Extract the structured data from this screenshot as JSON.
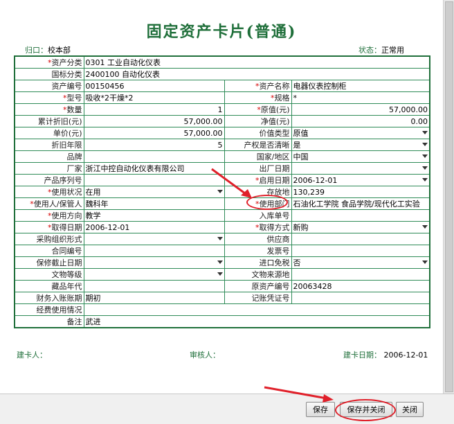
{
  "title": "固定资产卡片(普通)",
  "header": {
    "owner_label": "归口：",
    "owner_value": "校本部",
    "status_label": "状态：",
    "status_value": "正常用"
  },
  "fields": {
    "asset_category": {
      "label": "资产分类",
      "value": "0301 工业自动化仪表"
    },
    "national_category": {
      "label": "国标分类",
      "value": "2400100 自动化仪表"
    },
    "asset_no": {
      "label": "资产编号",
      "value": "00150456"
    },
    "asset_name": {
      "label": "资产名称",
      "value": "电器仪表控制柜"
    },
    "model": {
      "label": "型号",
      "value": "吸收*2干燥*2"
    },
    "spec": {
      "label": "规格",
      "value": "*"
    },
    "quantity": {
      "label": "数量",
      "value": "1"
    },
    "original_value": {
      "label": "原值(元)",
      "value": "57,000.00"
    },
    "accum_depr": {
      "label": "累计折旧(元)",
      "value": "57,000.00"
    },
    "net_value": {
      "label": "净值(元)",
      "value": "0.00"
    },
    "unit_price": {
      "label": "单价(元)",
      "value": "57,000.00"
    },
    "value_type": {
      "label": "价值类型",
      "value": "原值"
    },
    "depr_years": {
      "label": "折旧年限",
      "value": "5"
    },
    "ownership_clear": {
      "label": "产权是否清晰",
      "value": "是"
    },
    "brand": {
      "label": "品牌",
      "value": ""
    },
    "country": {
      "label": "国家/地区",
      "value": "中国"
    },
    "manufacturer": {
      "label": "厂家",
      "value": "浙江中控自动化仪表有限公司"
    },
    "factory_date": {
      "label": "出厂日期",
      "value": ""
    },
    "serial_no": {
      "label": "产品序列号",
      "value": ""
    },
    "start_date": {
      "label": "启用日期",
      "value": "2006-12-01"
    },
    "use_status": {
      "label": "使用状况",
      "value": "在用"
    },
    "location": {
      "label": "存放地",
      "value": "130,239"
    },
    "user": {
      "label": "使用人/保管人",
      "value": "魏科年"
    },
    "user_dept": {
      "label": "使用部门",
      "value": "石油化工学院 食品学院/现代化工实验"
    },
    "use_direction": {
      "label": "使用方向",
      "value": "教学"
    },
    "warehouse_no": {
      "label": "入库单号",
      "value": ""
    },
    "acquire_date": {
      "label": "取得日期",
      "value": "2006-12-01"
    },
    "acquire_method": {
      "label": "取得方式",
      "value": "新购"
    },
    "procurement_form": {
      "label": "采购组织形式",
      "value": ""
    },
    "supplier": {
      "label": "供应商",
      "value": ""
    },
    "contract_no": {
      "label": "合同编号",
      "value": ""
    },
    "invoice_no": {
      "label": "发票号",
      "value": ""
    },
    "warranty_end": {
      "label": "保修截止日期",
      "value": ""
    },
    "import_tax_free": {
      "label": "进口免税",
      "value": "否"
    },
    "relic_grade": {
      "label": "文物等级",
      "value": ""
    },
    "relic_source": {
      "label": "文物来源地",
      "value": ""
    },
    "collection_era": {
      "label": "藏品年代",
      "value": ""
    },
    "orig_asset_no": {
      "label": "原资产编号",
      "value": "20063428"
    },
    "finance_period": {
      "label": "财务入账账期",
      "value": "期初"
    },
    "voucher_no": {
      "label": "记账凭证号",
      "value": ""
    },
    "funding": {
      "label": "经费使用情况",
      "value": ""
    },
    "remark": {
      "label": "备注",
      "value": "武进"
    }
  },
  "signatures": {
    "creator_label": "建卡人：",
    "reviewer_label": "审核人：",
    "created_date_label": "建卡日期：",
    "created_date_value": "2006-12-01"
  },
  "buttons": {
    "save": "保存",
    "save_close": "保存并关闭",
    "close": "关闭"
  },
  "colors": {
    "title_green": "#1f6f3a",
    "grid_green": "#2e8b57",
    "required_red": "#d40000",
    "annotation_red": "#e0202a"
  }
}
